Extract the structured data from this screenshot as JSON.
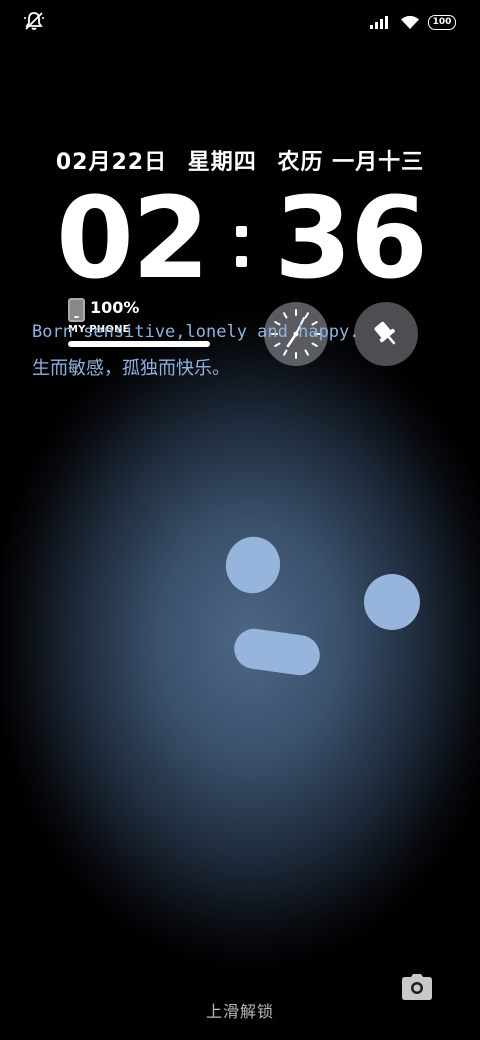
{
  "status_bar": {
    "battery_level": "100",
    "icons": [
      "mute-icon",
      "signal-icon",
      "wifi-icon",
      "battery-icon"
    ]
  },
  "lockscreen": {
    "date": "02月22日",
    "weekday": "星期四",
    "lunar": "农历 一月十三",
    "time_hours": "02",
    "time_minutes": "36"
  },
  "widgets": {
    "phone_battery_percent": "100%",
    "phone_name": "MY PHONE",
    "clock_widget_icon": "analog-clock-icon",
    "pin_widget_icon": "pushpin-icon"
  },
  "quote": {
    "english": "Born sensitive,lonely and happy.",
    "chinese": "生而敏感，孤独而快乐。"
  },
  "bottom": {
    "unlock_hint": "上滑解锁",
    "camera_icon": "camera-icon"
  },
  "colors": {
    "quote_text": "#8fb3e0",
    "wallpaper_face": "#97b4dc"
  }
}
